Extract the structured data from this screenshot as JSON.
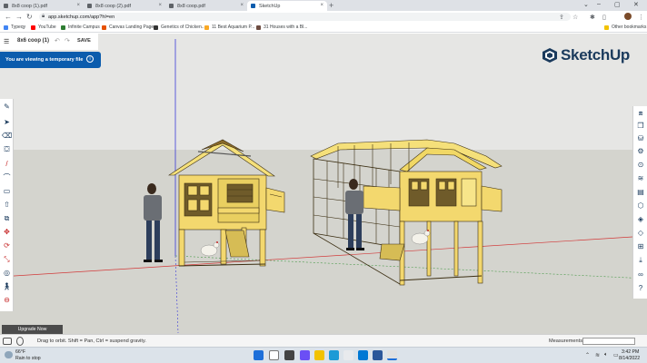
{
  "browser": {
    "tabs": [
      {
        "label": "8x8 coop (1).pdf",
        "active": false
      },
      {
        "label": "8x8 coop (2).pdf",
        "active": false
      },
      {
        "label": "8x8 coop.pdf",
        "active": false
      },
      {
        "label": "SketchUp",
        "active": true
      }
    ],
    "url": "app.sketchup.com/app?hl=en",
    "bookmarks": [
      {
        "label": "Typeqy",
        "color": "#4285f4"
      },
      {
        "label": "YouTube",
        "color": "#ff0000"
      },
      {
        "label": "Infinite Campus",
        "color": "#2e7d32"
      },
      {
        "label": "Canvas Landing Page",
        "color": "#e65100"
      },
      {
        "label": "Genetics of Chicken...",
        "color": "#333333"
      },
      {
        "label": "11 Best Aquarium P...",
        "color": "#f9a825"
      },
      {
        "label": "31 Houses with a Bl...",
        "color": "#6d4c41"
      }
    ],
    "other_bookmarks": "Other bookmarks"
  },
  "app": {
    "file_name": "8x6 coop (1)",
    "save_label": "SAVE",
    "banner": "You are viewing a temporary file",
    "logo_text": "SketchUp",
    "upgrade_label": "Upgrade Now",
    "status_hint": "Drag to orbit. Shift = Pan, Ctrl = suspend gravity.",
    "measurements_label": "Measurements",
    "brand_color": "#0b5cad"
  },
  "left_tools": [
    "select-tool",
    "eraser-tool",
    "paint-bucket-tool",
    "line-tool",
    "arc-tool",
    "rectangle-tool",
    "push-pull-tool",
    "offset-tool",
    "move-tool",
    "rotate-tool",
    "scale-tool",
    "tape-measure-tool",
    "orbit-tool",
    "walk-tool",
    "section-plane-tool"
  ],
  "right_tools": [
    "entity-info",
    "components",
    "materials",
    "styles",
    "scenes",
    "layers",
    "outliner",
    "solid-tools",
    "instructor",
    "display",
    "views",
    "download",
    "feedback",
    "help"
  ],
  "taskbar": {
    "temperature": "66°F",
    "weather": "Rain to stop",
    "time": "3:42 PM",
    "date": "8/14/2022"
  }
}
